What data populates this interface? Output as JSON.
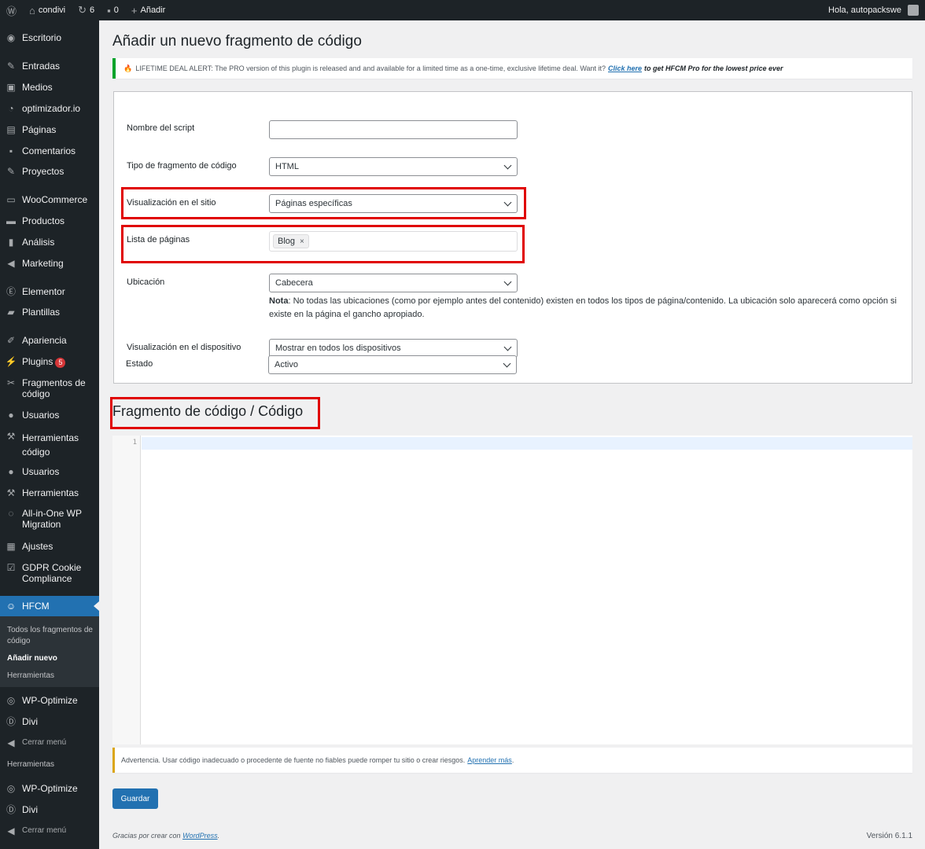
{
  "admin_bar": {
    "site_name": "condivi",
    "updates_count": "6",
    "comments_count": "0",
    "new_label": "Añadir",
    "greeting": "Hola, autopackswe"
  },
  "sidebar": {
    "items": [
      {
        "label": "Escritorio",
        "icon": "dashboard-icon"
      },
      {
        "label": "Entradas",
        "icon": "pin-icon"
      },
      {
        "label": "Medios",
        "icon": "media-icon"
      },
      {
        "label": "optimizador.io",
        "icon": "gauge-icon"
      },
      {
        "label": "Páginas",
        "icon": "pages-icon"
      },
      {
        "label": "Comentarios",
        "icon": "comment-icon"
      },
      {
        "label": "Proyectos",
        "icon": "pin-icon"
      },
      {
        "label": "WooCommerce",
        "icon": "woo-icon"
      },
      {
        "label": "Productos",
        "icon": "archive-icon"
      },
      {
        "label": "Análisis",
        "icon": "chart-icon"
      },
      {
        "label": "Marketing",
        "icon": "megaphone-icon"
      },
      {
        "label": "Elementor",
        "icon": "elementor-icon"
      },
      {
        "label": "Plantillas",
        "icon": "folder-icon"
      },
      {
        "label": "Apariencia",
        "icon": "brush-icon"
      },
      {
        "label": "Plugins",
        "icon": "plugin-icon",
        "badge": "5"
      },
      {
        "label": "Fragmentos de código",
        "icon": "scissors-icon"
      },
      {
        "label": "Usuarios",
        "icon": "user-icon"
      },
      {
        "label": "Herramientas código",
        "icon": "wrench-icon"
      },
      {
        "label": "Usuarios",
        "icon": "user-icon"
      },
      {
        "label": "Herramientas",
        "icon": "wrench-icon"
      },
      {
        "label": "All-in-One WP Migration",
        "icon": "migration-icon"
      },
      {
        "label": "Ajustes",
        "icon": "settings-icon"
      },
      {
        "label": "GDPR Cookie Compliance",
        "icon": "checkbox-icon"
      }
    ],
    "current": {
      "label": "HFCM",
      "icon": "robot-icon"
    },
    "submenu": [
      {
        "label": "Todos los fragmentos de código"
      },
      {
        "label": "Añadir nuevo"
      },
      {
        "label": "Herramientas"
      }
    ],
    "after": [
      {
        "label": "WP-Optimize",
        "icon": "optimize-icon"
      },
      {
        "label": "Divi",
        "icon": "divi-icon"
      },
      {
        "label": "Cerrar menú",
        "icon": "collapse-icon"
      },
      {
        "label": "Herramientas"
      },
      {
        "label": "WP-Optimize",
        "icon": "optimize-icon"
      },
      {
        "label": "Divi",
        "icon": "divi-icon"
      },
      {
        "label": "Cerrar menú",
        "icon": "collapse-icon"
      }
    ]
  },
  "page": {
    "title": "Añadir un nuevo fragmento de código",
    "promo": {
      "text": "LIFETIME DEAL ALERT: The PRO version of this plugin is released and and available for a limited time as a one-time, exclusive lifetime deal. Want it?",
      "link": "Click here",
      "tail": "to get HFCM Pro for the lowest price ever"
    },
    "form": {
      "script_name_label": "Nombre del script",
      "script_name_value": "",
      "snippet_type_label": "Tipo de fragmento de código",
      "snippet_type_value": "HTML",
      "site_display_label": "Visualización en el sitio",
      "site_display_value": "Páginas específicas",
      "pages_list_label": "Lista de páginas",
      "pages_tag": "Blog",
      "pages_tag_remove": "×",
      "location_label": "Ubicación",
      "location_value": "Cabecera",
      "note_bold": "Nota",
      "note_text": ": No todas las ubicaciones (como por ejemplo antes del contenido) existen en todos los tipos de página/contenido. La ubicación solo aparecerá como opción si existe en la página el gancho apropiado.",
      "device_label": "Visualización en el dispositivo",
      "device_value": "Mostrar en todos los dispositivos",
      "status_label": "Estado",
      "status_value": "Activo"
    },
    "code_section_title": "Fragmento de código / Código",
    "editor": {
      "line_number": "1"
    },
    "warning": {
      "text": "Advertencia. Usar código inadecuado o procedente de fuente no fiables puede romper tu sitio o crear riesgos.",
      "link": "Aprender más",
      "end": "."
    },
    "save_label": "Guardar"
  },
  "footer": {
    "thanks": "Gracias por crear con",
    "wp_link": "WordPress",
    "period": ".",
    "version": "Versión 6.1.1"
  },
  "colors": {
    "accent": "#2271b1",
    "highlight": "#e00000",
    "sidebar_bg": "#1d2327"
  }
}
